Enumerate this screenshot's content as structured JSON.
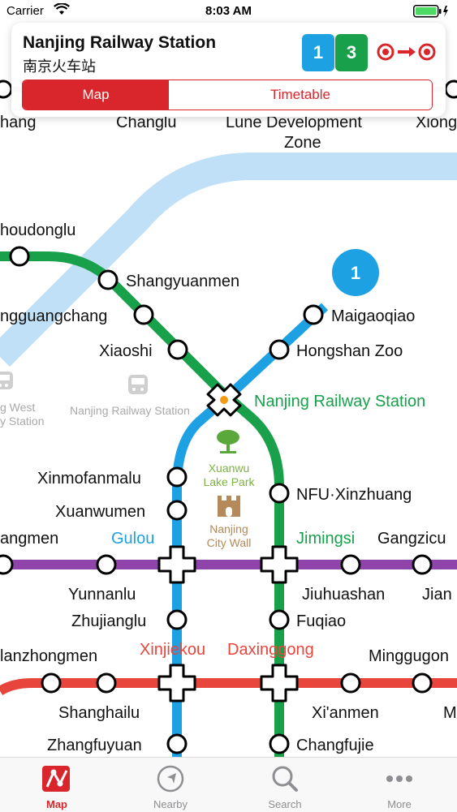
{
  "status_bar": {
    "carrier": "Carrier",
    "time": "8:03 AM"
  },
  "header": {
    "station_en": "Nanjing Railway Station",
    "station_zh": "南京火车站",
    "lines": [
      "1",
      "3"
    ],
    "segments": {
      "map": "Map",
      "timetable": "Timetable"
    }
  },
  "colors": {
    "line1_blue": "#1ea1e3",
    "line3_green": "#18a04b",
    "line2_red": "#e8453c",
    "line4_purple": "#8e44a8",
    "accent_red": "#d9262c"
  },
  "map": {
    "partial_labels": {
      "hang": "hang",
      "changlu": "Changlu",
      "lune": "Lune Development",
      "zone": "Zone",
      "xiong": "Xiong",
      "houdonglu": "houdonglu",
      "ngguangchang": "ngguangchang",
      "gwest": "g West",
      "ystation": "y Station",
      "angmen": "angmen",
      "gangzicu": "Gangzicu",
      "jian": "Jian",
      "lanzhongmen": "lanzhongmen",
      "minggugon": "Minggugon",
      "m": "M"
    },
    "line_badge_number": "1",
    "stations": {
      "shangyuanmen": "Shangyuanmen",
      "maigaoqiao": "Maigaoqiao",
      "xiaoshi": "Xiaoshi",
      "hongshan_zoo": "Hongshan Zoo",
      "nanjing_railway_station": "Nanjing Railway Station",
      "xinmofanmalu": "Xinmofanmalu",
      "nfu_xinzhuang": "NFU·Xinzhuang",
      "xuanwumen": "Xuanwumen",
      "gulou": "Gulou",
      "jimingsi": "Jimingsi",
      "yunnanlu": "Yunnanlu",
      "jiuhuashan": "Jiuhuashan",
      "zhujianglu": "Zhujianglu",
      "fuqiao": "Fuqiao",
      "xinjiekou": "Xinjiekou",
      "daxinggong": "Daxinggong",
      "shanghailu": "Shanghailu",
      "xianmen": "Xi'anmen",
      "zhangfuyuan": "Zhangfuyuan",
      "changfujie": "Changfujie"
    },
    "landmarks": {
      "railway_station_icon_label": "Nanjing Railway Station",
      "xuanwu_line1": "Xuanwu",
      "xuanwu_line2": "Lake Park",
      "city_wall_line1": "Nanjing",
      "city_wall_line2": "City Wall"
    }
  },
  "tabs": [
    {
      "label": "Map",
      "icon": "map-icon",
      "active": true
    },
    {
      "label": "Nearby",
      "icon": "compass-icon",
      "active": false
    },
    {
      "label": "Search",
      "icon": "search-icon",
      "active": false
    },
    {
      "label": "More",
      "icon": "more-icon",
      "active": false
    }
  ]
}
